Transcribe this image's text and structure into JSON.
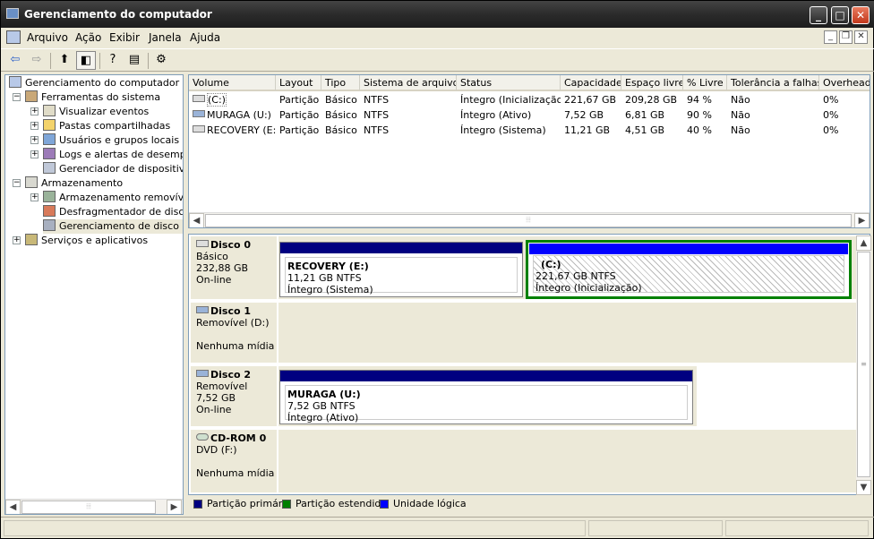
{
  "window": {
    "title": "Gerenciamento do computador"
  },
  "menu": [
    "Arquivo",
    "Ação",
    "Exibir",
    "Janela",
    "Ajuda"
  ],
  "tree": [
    {
      "label": "Gerenciamento do computador (local)",
      "level": 0,
      "exp": ""
    },
    {
      "label": "Ferramentas do sistema",
      "level": 1,
      "exp": "−"
    },
    {
      "label": "Visualizar eventos",
      "level": 2,
      "exp": "+"
    },
    {
      "label": "Pastas compartilhadas",
      "level": 2,
      "exp": "+"
    },
    {
      "label": "Usuários e grupos locais",
      "level": 2,
      "exp": "+"
    },
    {
      "label": "Logs e alertas de desempenho",
      "level": 2,
      "exp": "+"
    },
    {
      "label": "Gerenciador de dispositivos",
      "level": 2,
      "exp": ""
    },
    {
      "label": "Armazenamento",
      "level": 1,
      "exp": "−"
    },
    {
      "label": "Armazenamento removível",
      "level": 2,
      "exp": "+"
    },
    {
      "label": "Desfragmentador de disco",
      "level": 2,
      "exp": ""
    },
    {
      "label": "Gerenciamento de disco",
      "level": 2,
      "exp": ""
    },
    {
      "label": "Serviços e aplicativos",
      "level": 1,
      "exp": "+"
    }
  ],
  "volumes": {
    "columns": [
      "Volume",
      "Layout",
      "Tipo",
      "Sistema de arquivos",
      "Status",
      "Capacidade",
      "Espaço livre",
      "% Livre",
      "Tolerância a falhas",
      "Overhead"
    ],
    "rows": [
      [
        "(C:)",
        "Partição",
        "Básico",
        "NTFS",
        "Íntegro (Inicialização)",
        "221,67 GB",
        "209,28 GB",
        "94 %",
        "Não",
        "0%"
      ],
      [
        "MURAGA (U:)",
        "Partição",
        "Básico",
        "NTFS",
        "Íntegro (Ativo)",
        "7,52 GB",
        "6,81 GB",
        "90 %",
        "Não",
        "0%"
      ],
      [
        "RECOVERY (E:)",
        "Partição",
        "Básico",
        "NTFS",
        "Íntegro (Sistema)",
        "11,21 GB",
        "4,51 GB",
        "40 %",
        "Não",
        "0%"
      ]
    ]
  },
  "disks": [
    {
      "name": "Disco 0",
      "lines": [
        "Básico",
        "232,88 GB",
        "On-line"
      ]
    },
    {
      "name": "Disco 1",
      "lines": [
        "Removível (D:)",
        "",
        "Nenhuma mídia"
      ]
    },
    {
      "name": "Disco 2",
      "lines": [
        "Removível",
        "7,52 GB",
        "On-line"
      ]
    },
    {
      "name": "CD-ROM 0",
      "lines": [
        "DVD (F:)",
        "",
        "Nenhuma mídia"
      ]
    }
  ],
  "partitions": {
    "recovery": {
      "name": "RECOVERY  (E:)",
      "size": "11,21 GB NTFS",
      "status": "Íntegro (Sistema)"
    },
    "c": {
      "name": "(C:)",
      "size": "221,67 GB NTFS",
      "status": "Íntegro (Inicialização)"
    },
    "muraga": {
      "name": "MURAGA  (U:)",
      "size": "7,52 GB NTFS",
      "status": "Íntegro (Ativo)"
    }
  },
  "legend": [
    {
      "label": "Partição primária",
      "color": "#000080"
    },
    {
      "label": "Partição estendida",
      "color": "#008000"
    },
    {
      "label": "Unidade lógica",
      "color": "#0000FF"
    }
  ],
  "colors": {
    "primary": "#000080",
    "extended": "#008000",
    "logical": "#0000FF",
    "selection": "#008000"
  },
  "icons": {
    "toolbar": [
      "back-arrow-icon",
      "forward-arrow-icon",
      "up-folder-icon",
      "show-hide-tree-icon",
      "help-icon",
      "export-list-icon",
      "properties-icon"
    ]
  }
}
